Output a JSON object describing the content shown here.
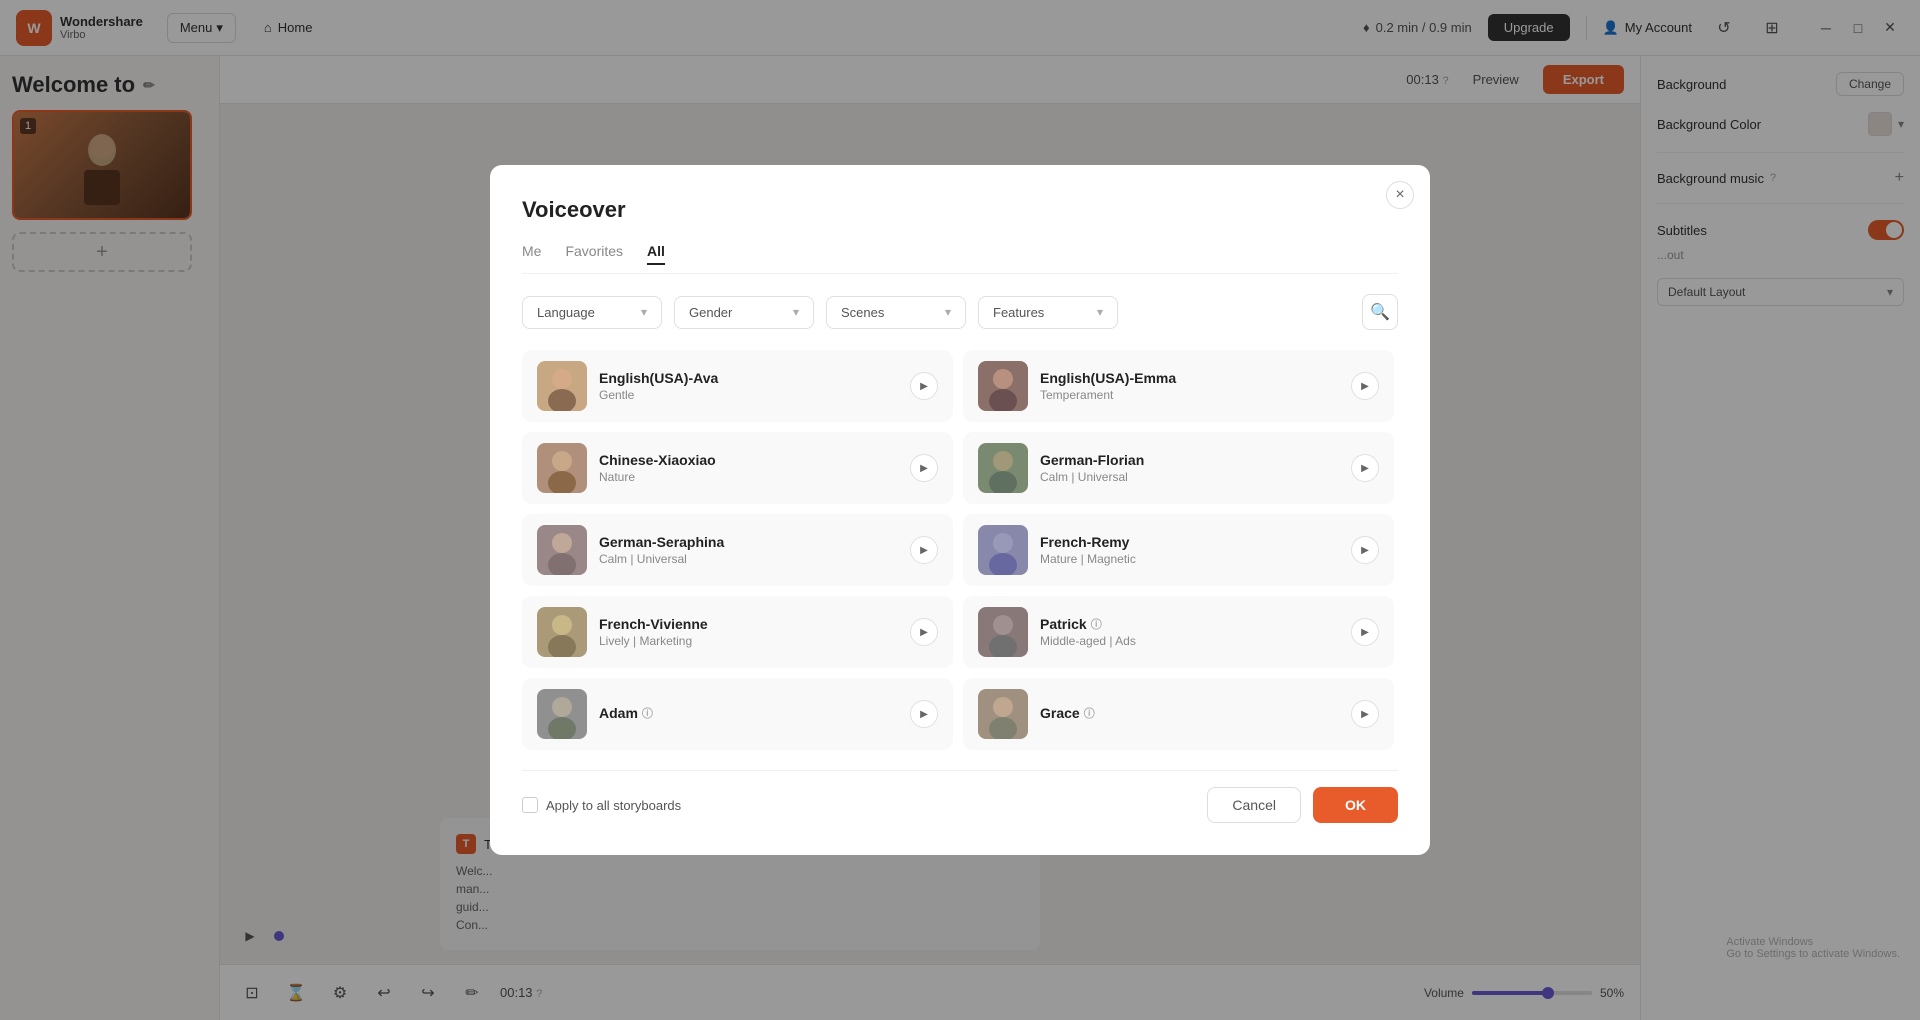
{
  "app": {
    "logo_brand": "Wondershare",
    "logo_product": "Virbo",
    "menu_label": "Menu",
    "home_label": "Home",
    "credits_label": "0.2 min / 0.9 min",
    "upgrade_label": "Upgrade",
    "my_account_label": "My Account"
  },
  "editor": {
    "welcome_text": "Welcome to",
    "time_display": "00:13",
    "preview_label": "Preview",
    "export_label": "Export",
    "volume_label": "Volume",
    "volume_percent": "50%",
    "volume_value": 50
  },
  "right_panel": {
    "background_label": "Background",
    "change_label": "Change",
    "background_color_label": "Background Color",
    "bg_music_label": "Background music",
    "subtitles_label": "Subtitles",
    "layout_label": "Default Layout"
  },
  "text_block": {
    "label": "Te...",
    "content": "Welc... many... guid... Con..."
  },
  "voiceover_modal": {
    "title": "Voiceover",
    "close_label": "×",
    "tabs": [
      {
        "id": "me",
        "label": "Me"
      },
      {
        "id": "favorites",
        "label": "Favorites"
      },
      {
        "id": "all",
        "label": "All",
        "active": true
      }
    ],
    "filters": {
      "language_placeholder": "Language",
      "gender_placeholder": "Gender",
      "scenes_placeholder": "Scenes",
      "features_placeholder": "Features"
    },
    "voices": [
      {
        "id": 1,
        "name": "English(USA)-Ava",
        "desc": "Gentle",
        "avatar_class": "av1",
        "emoji": "👩"
      },
      {
        "id": 2,
        "name": "English(USA)-Emma",
        "desc": "Temperament",
        "avatar_class": "av2",
        "emoji": "👩"
      },
      {
        "id": 3,
        "name": "Chinese-Xiaoxiao",
        "desc": "Nature",
        "avatar_class": "av3",
        "emoji": "👩"
      },
      {
        "id": 4,
        "name": "German-Florian",
        "desc": "Calm | Universal",
        "avatar_class": "av4",
        "emoji": "👨"
      },
      {
        "id": 5,
        "name": "German-Seraphina",
        "desc": "Calm | Universal",
        "avatar_class": "av5",
        "emoji": "👩"
      },
      {
        "id": 6,
        "name": "French-Remy",
        "desc": "Mature | Magnetic",
        "avatar_class": "av6",
        "emoji": "👨"
      },
      {
        "id": 7,
        "name": "French-Vivienne",
        "desc": "Lively | Marketing",
        "avatar_class": "av7",
        "emoji": "👩"
      },
      {
        "id": 8,
        "name": "Patrick",
        "desc": "Middle-aged | Ads",
        "avatar_class": "av8",
        "emoji": "👨",
        "has_info": true
      },
      {
        "id": 9,
        "name": "Adam",
        "desc": "",
        "avatar_class": "av9",
        "emoji": "👨",
        "has_info": true
      },
      {
        "id": 10,
        "name": "Grace",
        "desc": "",
        "avatar_class": "av10",
        "emoji": "👩",
        "has_info": true
      }
    ],
    "apply_label": "Apply to all storyboards",
    "cancel_label": "Cancel",
    "ok_label": "OK"
  },
  "watermark": {
    "line1": "Activate Windows",
    "line2": "Go to Settings to activate Windows."
  }
}
